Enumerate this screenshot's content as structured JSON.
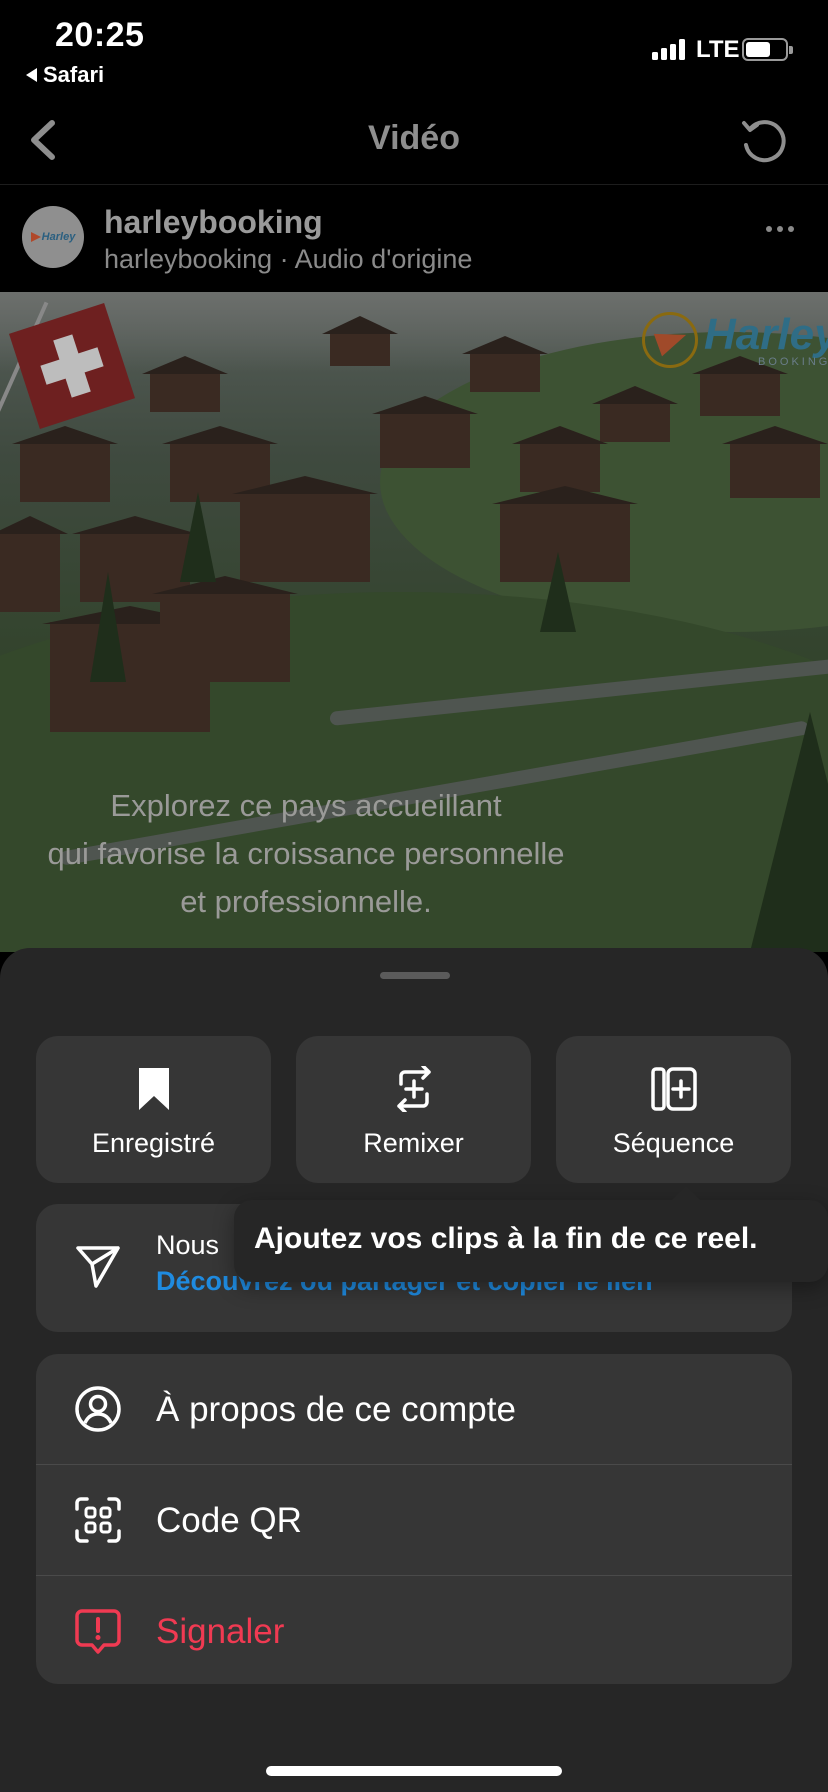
{
  "status_bar": {
    "time": "20:25",
    "back_app": "Safari",
    "network": "LTE",
    "icons": [
      "signal-icon",
      "battery-icon"
    ]
  },
  "nav": {
    "title": "Vidéo",
    "icons": [
      "chevron-left-icon",
      "refresh-icon"
    ]
  },
  "post": {
    "username": "harleybooking",
    "subline": "harleybooking · Audio d'origine",
    "avatar_text": "Harley"
  },
  "video": {
    "logo_text": "Harley",
    "logo_subtext": "BOOKING",
    "caption_lines": [
      "Explorez ce pays accueillant",
      "qui favorise la croissance personnelle",
      "et professionnelle."
    ]
  },
  "sheet": {
    "actions": [
      {
        "label": "Enregistré",
        "icon": "bookmark-icon"
      },
      {
        "label": "Remixer",
        "icon": "remix-icon"
      },
      {
        "label": "Séquence",
        "icon": "sequence-icon"
      }
    ],
    "share": {
      "title": "Nous",
      "subtitle": "Découvrez ou partager et copier le lien",
      "icon": "send-icon"
    },
    "tooltip": "Ajoutez vos clips à la fin de ce reel.",
    "menu": [
      {
        "label": "À propos de ce compte",
        "icon": "account-icon"
      },
      {
        "label": "Code QR",
        "icon": "qr-code-icon"
      },
      {
        "label": "Signaler",
        "icon": "report-icon"
      }
    ]
  },
  "colors": {
    "sheet_bg": "#262626",
    "button_bg": "#363636",
    "link_blue": "#1f8be0",
    "danger_red": "#f03a52"
  }
}
